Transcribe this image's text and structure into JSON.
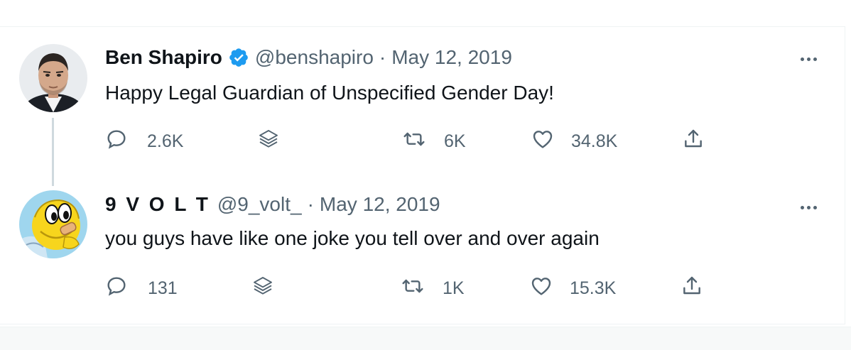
{
  "tweets": [
    {
      "name": "Ben Shapiro",
      "verified": true,
      "handle": "@benshapiro",
      "separator": "·",
      "date": "May 12, 2019",
      "text": "Happy Legal Guardian of Unspecified Gender Day!",
      "replies": "2.6K",
      "retweets": "6K",
      "likes": "34.8K"
    },
    {
      "name": "9 V O L T",
      "verified": false,
      "handle": "@9_volt_",
      "separator": "·",
      "date": "May 12, 2019",
      "text": "you guys have like one joke you tell over and over again",
      "replies": "131",
      "retweets": "1K",
      "likes": "15.3K"
    }
  ],
  "icons": {
    "reply": "reply-icon",
    "stack": "layers-icon",
    "retweet": "retweet-icon",
    "like": "heart-icon",
    "share": "share-icon",
    "more": "more-icon",
    "verified": "verified-badge-icon"
  },
  "colors": {
    "text": "#0f1419",
    "secondary": "#536471",
    "verified": "#1d9bf0",
    "thread_line": "#cfd9de",
    "border": "#eff3f4"
  }
}
